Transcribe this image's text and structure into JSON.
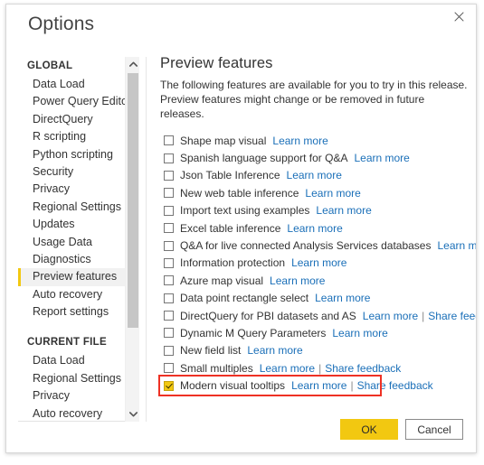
{
  "dialog": {
    "title": "Options",
    "close_icon": "close-icon"
  },
  "sidebar": {
    "groups": [
      {
        "header": "GLOBAL",
        "items": [
          {
            "label": "Data Load",
            "selected": false
          },
          {
            "label": "Power Query Editor",
            "selected": false
          },
          {
            "label": "DirectQuery",
            "selected": false
          },
          {
            "label": "R scripting",
            "selected": false
          },
          {
            "label": "Python scripting",
            "selected": false
          },
          {
            "label": "Security",
            "selected": false
          },
          {
            "label": "Privacy",
            "selected": false
          },
          {
            "label": "Regional Settings",
            "selected": false
          },
          {
            "label": "Updates",
            "selected": false
          },
          {
            "label": "Usage Data",
            "selected": false
          },
          {
            "label": "Diagnostics",
            "selected": false
          },
          {
            "label": "Preview features",
            "selected": true
          },
          {
            "label": "Auto recovery",
            "selected": false
          },
          {
            "label": "Report settings",
            "selected": false
          }
        ]
      },
      {
        "header": "CURRENT FILE",
        "items": [
          {
            "label": "Data Load",
            "selected": false
          },
          {
            "label": "Regional Settings",
            "selected": false
          },
          {
            "label": "Privacy",
            "selected": false
          },
          {
            "label": "Auto recovery",
            "selected": false
          }
        ]
      }
    ],
    "scrollbar": {
      "up_icon": "chevron-up-icon",
      "down_icon": "chevron-down-icon"
    }
  },
  "main": {
    "title": "Preview features",
    "description": "The following features are available for you to try in this release. Preview features might change or be removed in future releases.",
    "learn_more_label": "Learn more",
    "share_feedback_label": "Share feedback",
    "separator": "|",
    "features": [
      {
        "label": "Shape map visual",
        "checked": false,
        "learn_more": true,
        "share_feedback": false,
        "highlighted": false
      },
      {
        "label": "Spanish language support for Q&A",
        "checked": false,
        "learn_more": true,
        "share_feedback": false,
        "highlighted": false
      },
      {
        "label": "Json Table Inference",
        "checked": false,
        "learn_more": true,
        "share_feedback": false,
        "highlighted": false
      },
      {
        "label": "New web table inference",
        "checked": false,
        "learn_more": true,
        "share_feedback": false,
        "highlighted": false
      },
      {
        "label": "Import text using examples",
        "checked": false,
        "learn_more": true,
        "share_feedback": false,
        "highlighted": false
      },
      {
        "label": "Excel table inference",
        "checked": false,
        "learn_more": true,
        "share_feedback": false,
        "highlighted": false
      },
      {
        "label": "Q&A for live connected Analysis Services databases",
        "checked": false,
        "learn_more": true,
        "share_feedback": false,
        "highlighted": false
      },
      {
        "label": "Information protection",
        "checked": false,
        "learn_more": true,
        "share_feedback": false,
        "highlighted": false
      },
      {
        "label": "Azure map visual",
        "checked": false,
        "learn_more": true,
        "share_feedback": false,
        "highlighted": false
      },
      {
        "label": "Data point rectangle select",
        "checked": false,
        "learn_more": true,
        "share_feedback": false,
        "highlighted": false
      },
      {
        "label": "DirectQuery for PBI datasets and AS",
        "checked": false,
        "learn_more": true,
        "share_feedback": true,
        "highlighted": false
      },
      {
        "label": "Dynamic M Query Parameters",
        "checked": false,
        "learn_more": true,
        "share_feedback": false,
        "highlighted": false
      },
      {
        "label": "New field list",
        "checked": false,
        "learn_more": true,
        "share_feedback": false,
        "highlighted": false
      },
      {
        "label": "Small multiples",
        "checked": false,
        "learn_more": true,
        "share_feedback": true,
        "highlighted": false
      },
      {
        "label": "Modern visual tooltips",
        "checked": true,
        "learn_more": true,
        "share_feedback": true,
        "highlighted": true
      }
    ]
  },
  "footer": {
    "ok_label": "OK",
    "cancel_label": "Cancel"
  },
  "colors": {
    "accent": "#f2c811",
    "link": "#1a6fb8",
    "highlight": "#ee3124",
    "text": "#333333"
  }
}
